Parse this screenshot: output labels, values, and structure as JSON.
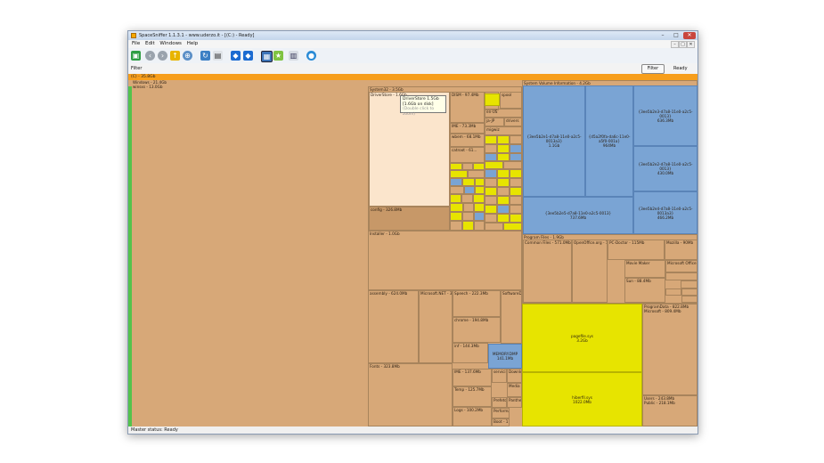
{
  "window": {
    "title": "SpaceSniffer 1.1.3.1 - www.uderzo.it - [(C:) - Ready]",
    "min_label": "–",
    "max_label": "□",
    "close_label": "✕"
  },
  "menu": {
    "items": [
      "File",
      "Edit",
      "Windows",
      "Help"
    ],
    "mdi_min": "–",
    "mdi_max": "□",
    "mdi_close": "✕"
  },
  "colors": {
    "folder": "#d7a878",
    "blue": "#7aa4d4",
    "yellow": "#e7e400",
    "drive": "#f79e1b",
    "free": "#54c34c"
  },
  "toolbar": {
    "icons": [
      "new-scan-icon",
      "back-icon",
      "forward-icon",
      "up-folder-icon",
      "zoom-icon",
      "refresh-icon",
      "document-icon",
      "shield-icon",
      "shield-alt-icon",
      "tree-icon",
      "star-icon",
      "save-icon",
      "settings-icon"
    ]
  },
  "filter": {
    "label": "Filter",
    "button": "Filter",
    "status": "Ready"
  },
  "drive_label": "(C) - 35.8Gb",
  "treemap": {
    "windows": "Windows - 21.4Gb",
    "winsxs": "winsxs - 13.0Gb",
    "system32": "System32 - 3.5Gb",
    "driverstore": "DriverStore - 1.6Gb",
    "filerepository": "FileRepository - 1.5Gb",
    "config": "config - 326.8Mb",
    "svi": "System Volume Information - 4.2Gb",
    "svi_files": [
      {
        "name": "{3ee5b2e1-d7a8-11e0-a2c5-0013a3}",
        "size": "1.1Gb"
      },
      {
        "name": "{d5a2f0fa-da6c-11e0-a5f0-001a}",
        "size": "964Mb"
      },
      {
        "name": "{3ee5b2e3-d7a8-11e0-a2c5-0013}",
        "size": "636.3Mb"
      },
      {
        "name": "{3ee5b2e2-d7a8-11e0-a2c5-0013}",
        "size": "430.0Mb"
      },
      {
        "name": "{3ee5b2e4-d7a8-11e0-a2c5-0013a3}",
        "size": "466.2Mb"
      },
      {
        "name": "{3ee5b2e5-d7a8-11e0-a2c5-0013}",
        "size": "737.6Mb"
      }
    ],
    "installer": "Installer - 1.0Gb",
    "assembly": "assembly - 624.0Mb",
    "dotnet": "Microsoft.NET - 312.5Mb",
    "speech": "Speech - 222.3Mb",
    "softdist": "SoftwareD",
    "chrome": "chrome - 194.8Mb",
    "inf": "inf - 144.3Mb",
    "memory": {
      "name": "MEMORY.DMP",
      "size": "141.1Mb"
    },
    "fonts": "Fonts - 323.8Mb",
    "ime": "IME - 137.6Mb",
    "temp": "Temp - 125.7Mb",
    "logs": "Logs - 100.2Mb",
    "servicing": "servicing",
    "downloaded": "Downloaded",
    "media": "Media",
    "prefetch": "Prefetch",
    "panther": "Panther",
    "perform": "Performance",
    "boot": "Boot - 1",
    "program_files": "Program Files - 1.9Gb",
    "common_files": "Common Files - 571.0Mb",
    "openoffice": "OpenOffice.org - 1...",
    "pcdoctor": "PC-Doctor - 115Mb",
    "mozilla": "Mozilla - 90Mb",
    "movie_maker": "Movie Maker",
    "sun": "Sun - 88.4Mb",
    "ms_office": "Microsoft Office",
    "pagefile": {
      "name": "pagefile.sys",
      "size": "3.2Gb"
    },
    "hiberfil": {
      "name": "hiberfil.sys",
      "size": "1022.0Mb"
    },
    "programdata": "ProgramData - 822.8Mb",
    "microsoft_pd": "Microsoft - 809.4Mb",
    "users": "Users - 243.8Mb",
    "public": "Public - 218.1Mb",
    "system32_subs": [
      "DISM - 97.4Mb",
      "IME - 73.3Mb",
      "wbem - 68.1Mb",
      "catroot - 61...",
      "spool",
      "en-US",
      "ja-JP",
      "drivers",
      "migwiz"
    ]
  },
  "tooltip": {
    "name": "DriverStore",
    "size": "1.5Gb [1.6Gb on disk]",
    "hint": "(Double click to zoom)"
  },
  "status": "Master status: Ready"
}
